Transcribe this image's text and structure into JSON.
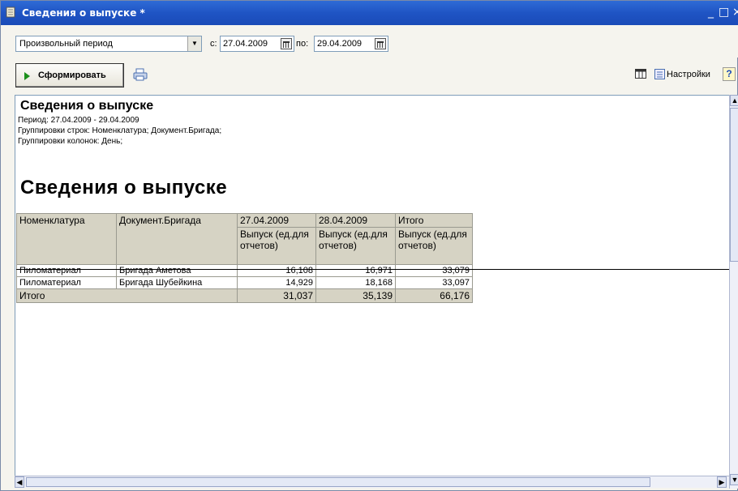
{
  "window": {
    "title": "Сведения о выпуске *",
    "controls": [
      "_",
      "□",
      "×"
    ]
  },
  "period": {
    "selected": "Произвольный период",
    "from_label": "с:",
    "from_value": "27.04.2009",
    "to_label": "по:",
    "to_value": "29.04.2009"
  },
  "toolbar": {
    "generate_label": "Сформировать",
    "settings_label": "Настройки",
    "help_label": "?"
  },
  "report": {
    "title": "Сведения о выпуске",
    "period_line": "Период: 27.04.2009 - 29.04.2009",
    "row_groups_line": "Группировки строк: Номенклатура; Документ.Бригада;",
    "col_groups_line": "Группировки колонок: День;",
    "big_title": "Сведения о выпуске",
    "columns": {
      "nomenclature": "Номенклатура",
      "brigade": "Документ.Бригада",
      "d1": "27.04.2009",
      "d2": "28.04.2009",
      "total": "Итого",
      "measure": "Выпуск (ед.для отчетов)"
    },
    "rows": [
      {
        "nomenclature": "Пиломатериал",
        "brigade": "Бригада Аметова",
        "d1": "16,108",
        "d2": "16,971",
        "total": "33,079"
      },
      {
        "nomenclature": "Пиломатериал",
        "brigade": "Бригада Шубейкина",
        "d1": "14,929",
        "d2": "18,168",
        "total": "33,097"
      }
    ],
    "totals": {
      "label": "Итого",
      "d1": "31,037",
      "d2": "35,139",
      "total": "66,176"
    }
  }
}
